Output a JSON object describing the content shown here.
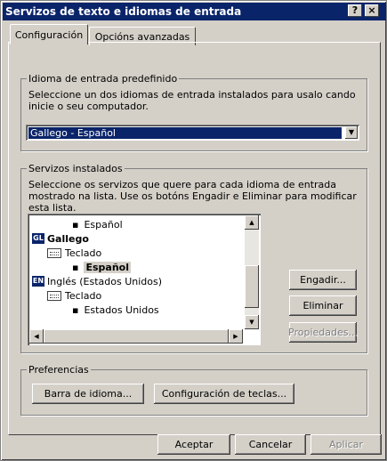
{
  "window": {
    "title": "Servizos de texto e idiomas de entrada",
    "help_label": "?",
    "close_label": "×"
  },
  "tabs": [
    {
      "label": "Configuración",
      "active": true
    },
    {
      "label": "Opcións avanzadas",
      "active": false
    }
  ],
  "default_language": {
    "legend": "Idioma de entrada predefinido",
    "description": "Seleccione un dos idiomas de entrada instalados para usalo cando inicie o seu computador.",
    "selected": "Gallego - Español"
  },
  "installed_services": {
    "legend": "Servizos instalados",
    "description": "Seleccione os servizos que quere para cada idioma de entrada mostrado na lista. Use os botóns Engadir e Eliminar para modificar esta lista.",
    "tree": [
      {
        "text": "Español",
        "type": "layout"
      },
      {
        "text": "Gallego",
        "type": "language",
        "badge": "GL"
      },
      {
        "text": "Teclado",
        "type": "category"
      },
      {
        "text": "Español",
        "type": "layout",
        "selected": true
      },
      {
        "text": "Inglés (Estados Unidos)",
        "type": "language",
        "badge": "EN"
      },
      {
        "text": "Teclado",
        "type": "category"
      },
      {
        "text": "Estados Unidos",
        "type": "layout"
      }
    ],
    "add_label": "Engadir...",
    "remove_label": "Eliminar",
    "properties_label": "Propiedades..."
  },
  "preferences": {
    "legend": "Preferencias",
    "language_bar_label": "Barra de idioma...",
    "key_settings_label": "Configuración de teclas..."
  },
  "footer": {
    "ok_label": "Aceptar",
    "cancel_label": "Cancelar",
    "apply_label": "Aplicar"
  }
}
